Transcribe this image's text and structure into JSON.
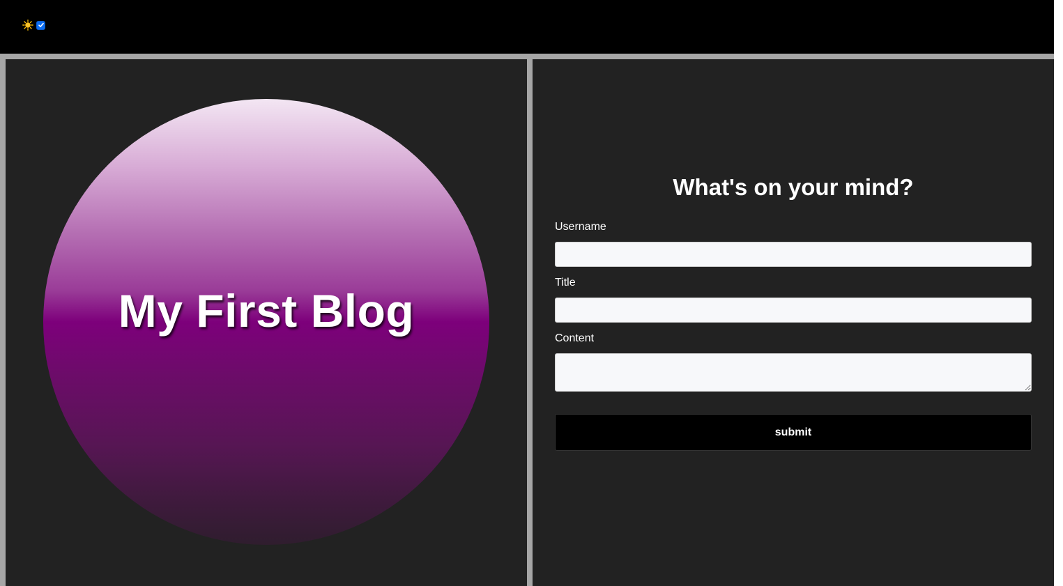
{
  "header": {
    "theme_icon": "sun-icon",
    "dark_mode_checked": true
  },
  "hero": {
    "title": "My First Blog"
  },
  "form": {
    "heading": "What's on your mind?",
    "username_label": "Username",
    "username_value": "",
    "title_label": "Title",
    "title_value": "",
    "content_label": "Content",
    "content_value": "",
    "submit_label": "submit"
  },
  "colors": {
    "topbar": "#000000",
    "panel": "#222222",
    "gutter": "#a6a6a6",
    "accent_purple": "#7d007b",
    "input_bg": "#f7f8fa",
    "button_bg": "#000000"
  }
}
